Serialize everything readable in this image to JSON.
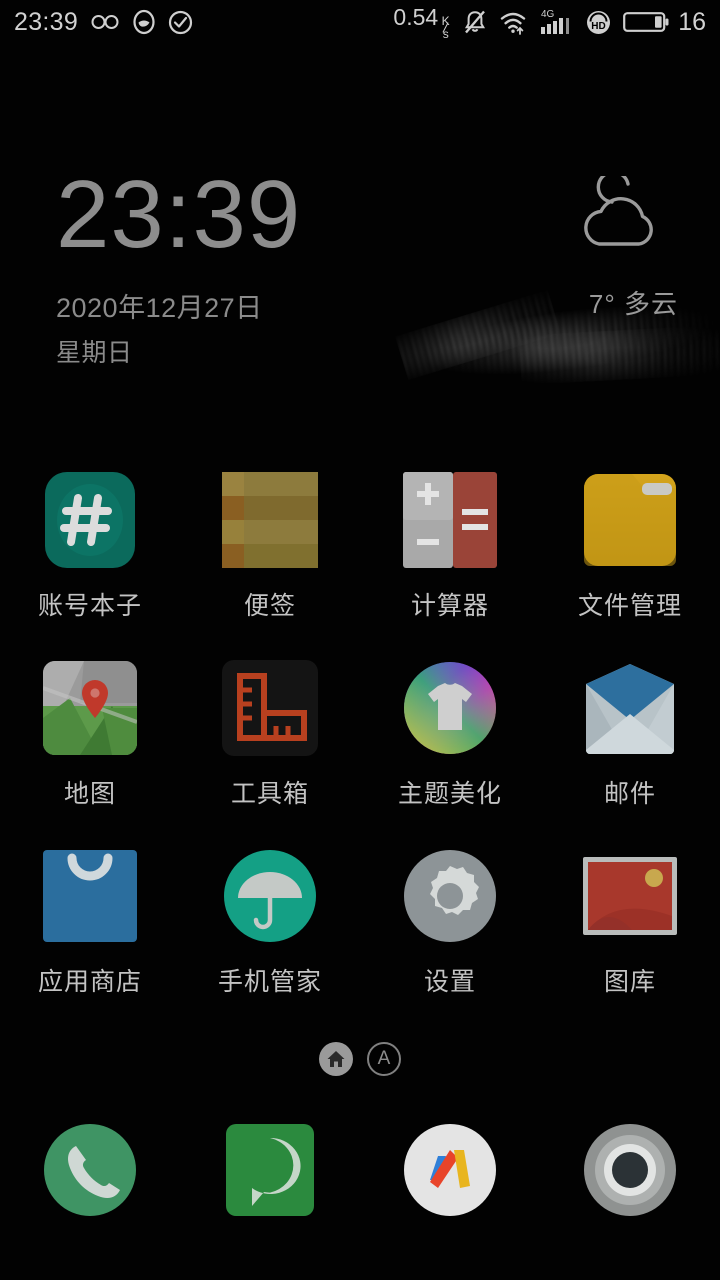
{
  "status_bar": {
    "clock": "23:39",
    "left_icons": [
      {
        "name": "infinity-icon",
        "glyph": "∞"
      },
      {
        "name": "cloud-sync-icon",
        "glyph": "●"
      },
      {
        "name": "check-circle-icon",
        "glyph": "✓"
      }
    ],
    "network_speed": "0.54",
    "speed_unit_top": "K",
    "speed_unit_bottom": "s",
    "right_icons": [
      {
        "name": "silent-bell-icon"
      },
      {
        "name": "wifi-icon"
      },
      {
        "name": "signal-4g-icon",
        "label": "4G"
      },
      {
        "name": "volte-hd-icon",
        "label": "HD"
      },
      {
        "name": "battery-icon"
      }
    ],
    "battery_level": "16"
  },
  "clock_widget": {
    "time": "23:39",
    "date": "2020年12月27日",
    "weekday": "星期日"
  },
  "weather_widget": {
    "icon": "moon-cloud-icon",
    "text": "7° 多云",
    "temperature": "7°",
    "condition": "多云"
  },
  "apps": [
    {
      "label": "账号本子",
      "icon": "account-notebook-icon",
      "color": "#0b6a5c"
    },
    {
      "label": "便签",
      "icon": "notes-icon",
      "color": "#8a7638"
    },
    {
      "label": "计算器",
      "icon": "calculator-icon",
      "color": "#a9a9a9"
    },
    {
      "label": "文件管理",
      "icon": "file-manager-icon",
      "color": "#c79a18"
    },
    {
      "label": "地图",
      "icon": "maps-icon",
      "color": "#5a9a48"
    },
    {
      "label": "工具箱",
      "icon": "toolbox-icon",
      "color": "#b8401f"
    },
    {
      "label": "主题美化",
      "icon": "themes-icon",
      "color": "#b44bc8"
    },
    {
      "label": "邮件",
      "icon": "mail-icon",
      "color": "#2d6f9e"
    },
    {
      "label": "应用商店",
      "icon": "app-store-icon",
      "color": "#2b6e9e"
    },
    {
      "label": "手机管家",
      "icon": "phone-manager-icon",
      "color": "#14a085"
    },
    {
      "label": "设置",
      "icon": "settings-icon",
      "color": "#8d9497"
    },
    {
      "label": "图库",
      "icon": "gallery-icon",
      "color": "#a8382c"
    }
  ],
  "page_indicator": {
    "pages": [
      {
        "name": "home-page-dot",
        "state": "active",
        "glyph": "home"
      },
      {
        "name": "apps-page-dot",
        "state": "idle",
        "glyph": "A"
      }
    ]
  },
  "dock": [
    {
      "name": "phone-app",
      "label": "电话",
      "icon": "phone-icon",
      "color": "#3f9464"
    },
    {
      "name": "messages-app",
      "label": "短信",
      "icon": "message-icon",
      "color": "#2b8a3e"
    },
    {
      "name": "browser-app",
      "label": "浏览器",
      "icon": "browser-m-icon",
      "color": "#e8e8e8"
    },
    {
      "name": "camera-app",
      "label": "相机",
      "icon": "camera-icon",
      "color": "#9a9a9a"
    }
  ]
}
